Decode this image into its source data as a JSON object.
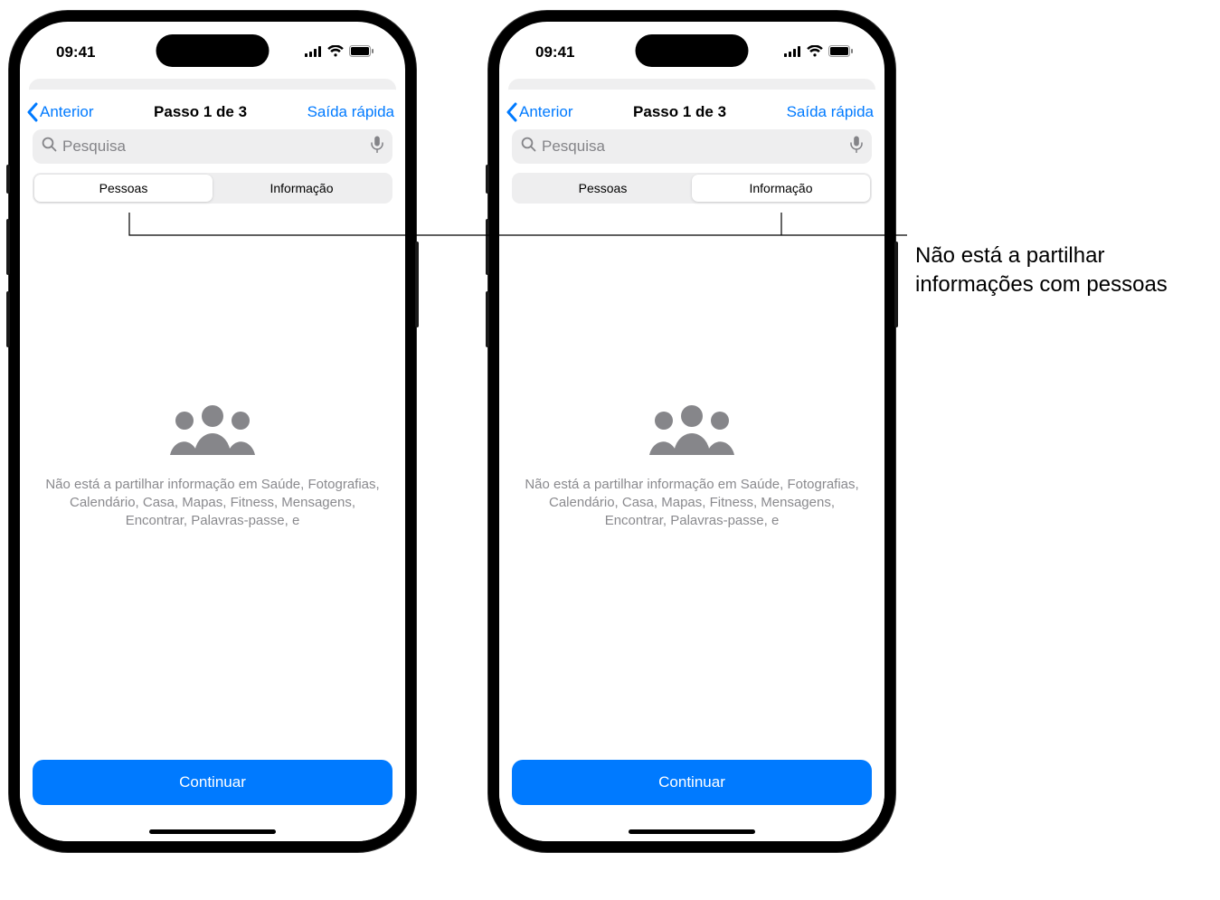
{
  "status": {
    "time": "09:41"
  },
  "nav": {
    "back": "Anterior",
    "title": "Passo 1 de 3",
    "right": "Saída rápida"
  },
  "search": {
    "placeholder": "Pesquisa"
  },
  "tabs": {
    "pessoas": "Pessoas",
    "informacao": "Informação"
  },
  "body": {
    "text": "Não está a partilhar informação em Saúde, Fotografias, Calendário, Casa, Mapas, Fitness, Mensagens, Encontrar, Palavras-passe, e"
  },
  "continue": "Continuar",
  "callout": "Não está a partilhar informações com pessoas"
}
